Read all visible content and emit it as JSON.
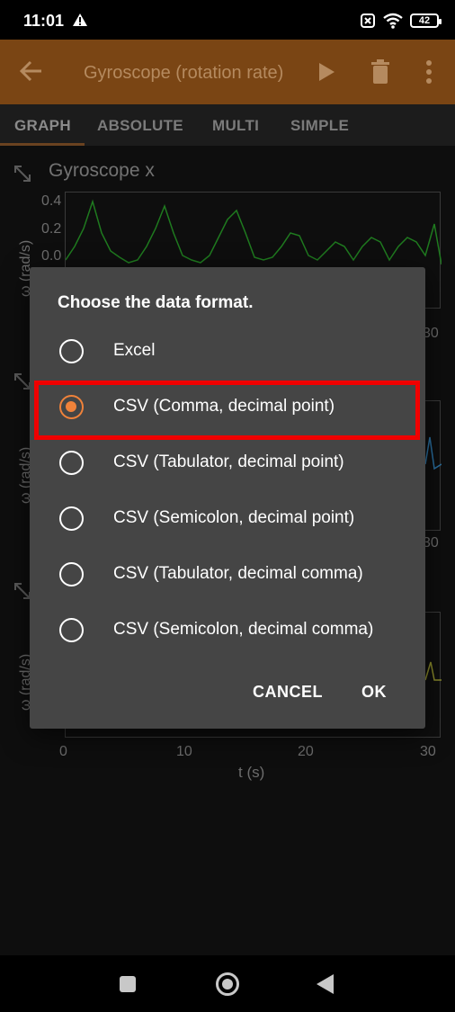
{
  "status_bar": {
    "time": "11:01",
    "battery": "42",
    "icons": [
      "warning-icon",
      "sim-error-icon",
      "wifi-icon",
      "battery-icon"
    ]
  },
  "app_bar": {
    "title": "Gyroscope (rotation rate)",
    "icons": [
      "back-arrow-icon",
      "play-icon",
      "trash-icon",
      "more-vert-icon"
    ]
  },
  "tabs": [
    "GRAPH",
    "ABSOLUTE",
    "MULTI",
    "SIMPLE"
  ],
  "graphs": [
    {
      "title": "Gyroscope x",
      "ylabel": "ω (rad/s)",
      "yticks": [
        "0.4",
        "0.2",
        "0.0"
      ],
      "xtick_visible": "30",
      "color": "#1f7a1f"
    },
    {
      "ylabel": "ω (rad/s)",
      "xtick_visible": "30",
      "color": "#2a6fa0"
    },
    {
      "ylabel": "ω (rad/s)",
      "xticks": [
        "0",
        "10",
        "20",
        "30"
      ],
      "xlabel": "t (s)",
      "color": "#8a8a2a"
    }
  ],
  "dialog": {
    "title": "Choose the data format.",
    "options": [
      {
        "label": "Excel",
        "selected": false
      },
      {
        "label": "CSV (Comma, decimal point)",
        "selected": true
      },
      {
        "label": "CSV (Tabulator, decimal point)",
        "selected": false
      },
      {
        "label": "CSV (Semicolon, decimal point)",
        "selected": false
      },
      {
        "label": "CSV (Tabulator, decimal comma)",
        "selected": false
      },
      {
        "label": "CSV (Semicolon, decimal comma)",
        "selected": false
      }
    ],
    "cancel_label": "CANCEL",
    "ok_label": "OK",
    "accent_color": "#f0823a",
    "highlight_color": "#f00000"
  },
  "nav_bar": {
    "icons": [
      "recents-square-icon",
      "home-circle-icon",
      "back-triangle-icon"
    ]
  }
}
